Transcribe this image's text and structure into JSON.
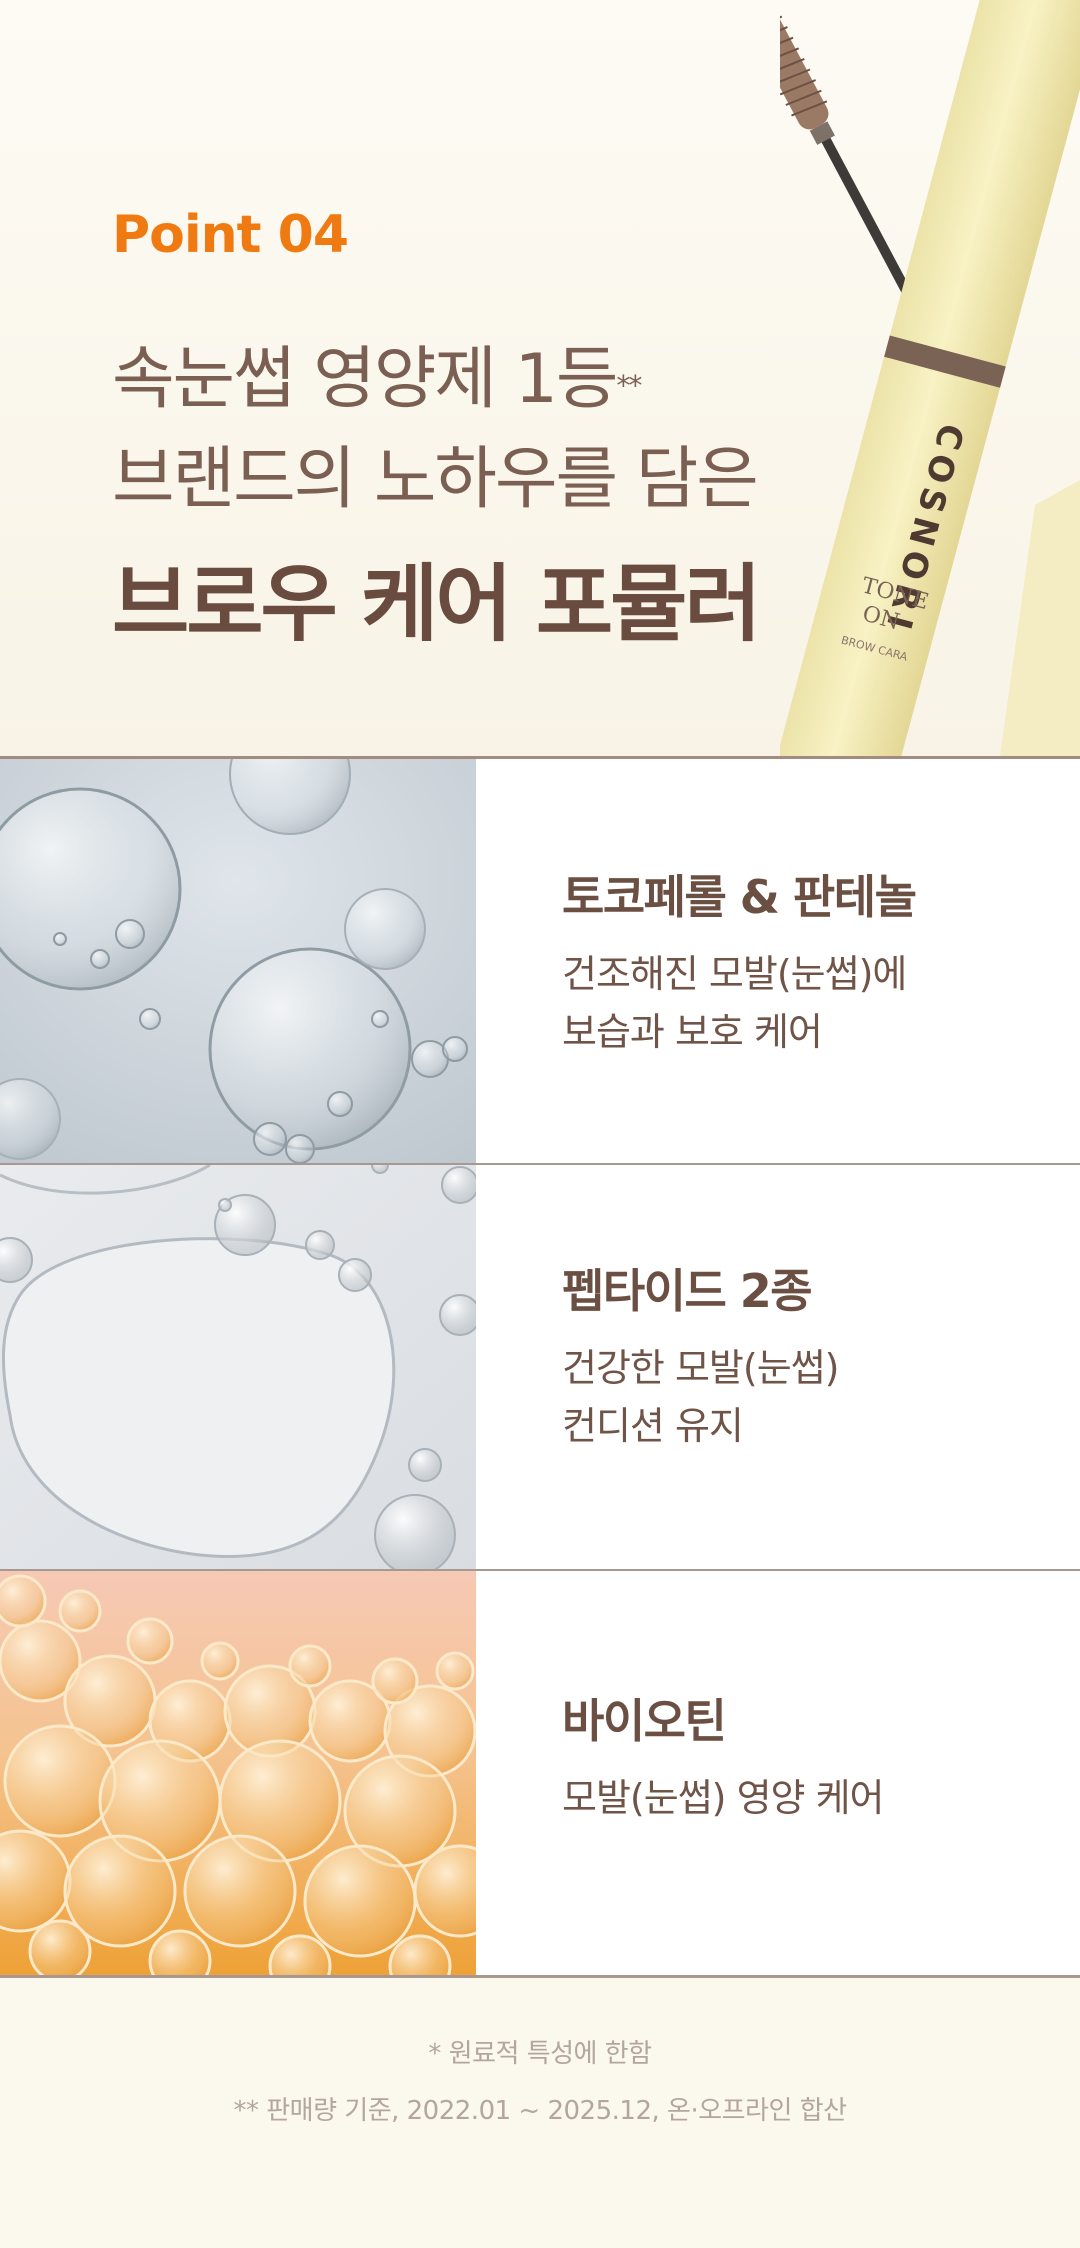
{
  "header": {
    "point_label": "Point 04",
    "headline_line1": "속눈썹 영양제 1등",
    "headline_line1_mark": "**",
    "headline_line2": "브랜드의 노하우를 담은",
    "headline_strong": "브로우 케어 포뮬러"
  },
  "product": {
    "brand": "COSNORI",
    "sub_logo_1": "TONE",
    "sub_logo_2": "ON",
    "sub_name": "BROW CARA"
  },
  "ingredients": [
    {
      "title": "토코페롤 & 판테놀",
      "desc_line1": "건조해진 모발(눈썹)에",
      "desc_line2": "보습과 보호 케어"
    },
    {
      "title": "펩타이드 2종",
      "desc_line1": "건강한 모발(눈썹)",
      "desc_line2": "컨디션 유지"
    },
    {
      "title": "바이오틴",
      "desc_line1": "모발(눈썹) 영양 케어"
    }
  ],
  "footnotes": {
    "note1": "* 원료적 특성에 한함",
    "note2": "** 판매량 기준, 2022.01 ~ 2025.12, 온·오프라인 합산"
  },
  "colors": {
    "accent": "#f07a12",
    "text_brown": "#6b4f42",
    "background": "#fbf8ee"
  }
}
